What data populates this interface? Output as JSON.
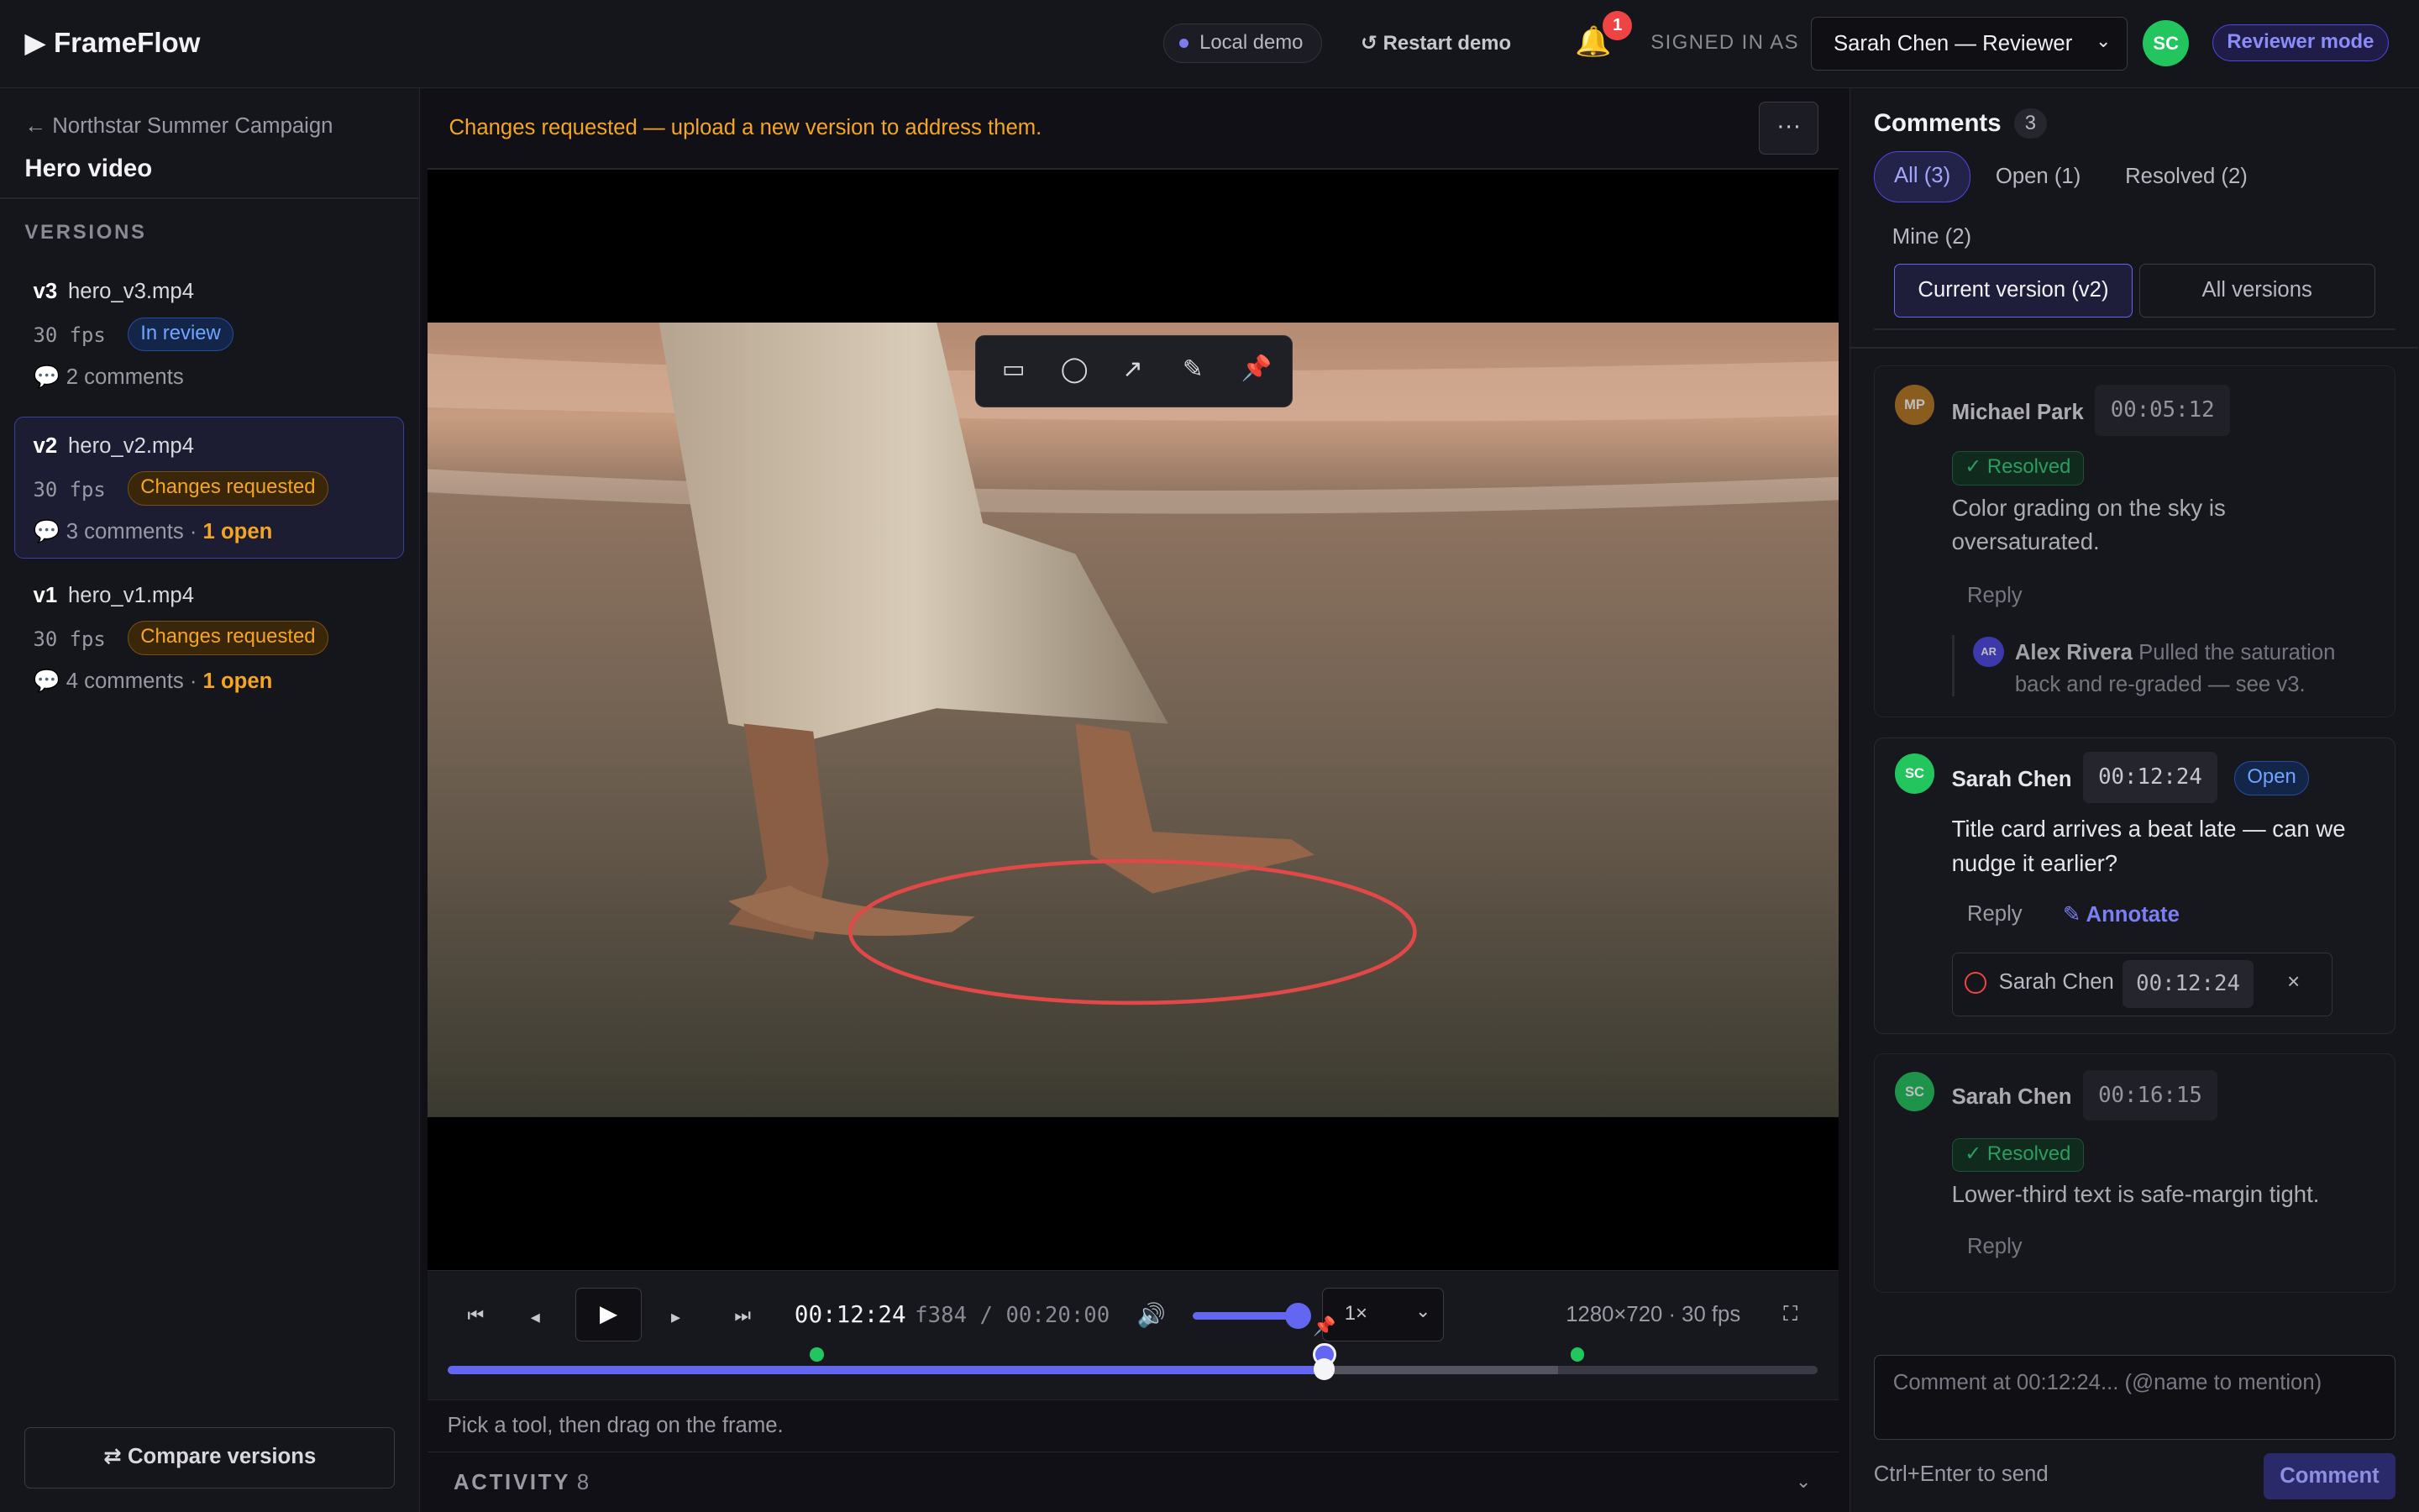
{
  "app": {
    "brand": "▶ FrameFlow"
  },
  "header": {
    "demo_label": "Local demo",
    "restart_label": "↺ Restart demo",
    "notification_count": "1",
    "signed_in_as": "SIGNED IN AS",
    "user_select_value": "Sarah Chen — Reviewer",
    "user_initials": "SC",
    "mode_badge": "Reviewer mode"
  },
  "sidebar": {
    "breadcrumb": "← Northstar Summer Campaign",
    "title": "Hero video",
    "versions_heading": "VERSIONS",
    "versions": [
      {
        "tag": "v3",
        "file": "hero_v3.mp4",
        "fps": "30 fps",
        "status": "In review",
        "comments": "2 comments",
        "open": ""
      },
      {
        "tag": "v2",
        "file": "hero_v2.mp4",
        "fps": "30 fps",
        "status": "Changes requested",
        "comments": "3 comments · ",
        "open": "1 open"
      },
      {
        "tag": "v1",
        "file": "hero_v1.mp4",
        "fps": "30 fps",
        "status": "Changes requested",
        "comments": "4 comments · ",
        "open": "1 open"
      }
    ],
    "compare_label": "⇄ Compare versions"
  },
  "main": {
    "status_message": "Changes requested — upload a new version to address them.",
    "more_label": "···",
    "annotation_tools": [
      "▭",
      "◯",
      "↗",
      "✎",
      "📌"
    ],
    "controls": {
      "timecode": "00:12:24",
      "frame_info": "f384 / 00:20:00",
      "speed": "1×",
      "resolution": "1280×720 · 30 fps",
      "volume": 0.85,
      "playhead_fraction": 0.64
    },
    "hint": "Pick a tool, then drag on the frame.",
    "activity_label": "ACTIVITY",
    "activity_count": "8"
  },
  "comments_panel": {
    "title": "Comments",
    "count": "3",
    "filters": [
      "All (3)",
      "Open (1)",
      "Resolved (2)",
      "Mine (2)"
    ],
    "scope": [
      "Current version (v2)",
      "All versions"
    ],
    "comments": [
      {
        "initials": "MP",
        "author": "Michael Park",
        "time": "00:05:12",
        "status": "✓ Resolved",
        "text": "Color grading on the sky is oversaturated.",
        "reply": "Reply",
        "thread_initials": "AR",
        "thread_author": "Alex Rivera",
        "thread_text": "Pulled the saturation back and re-graded — see v3."
      },
      {
        "initials": "SC",
        "author": "Sarah Chen",
        "time": "00:12:24",
        "status": "Open",
        "text": "Title card arrives a beat late — can we nudge it earlier?",
        "reply": "Reply",
        "annotate": "✎ Annotate",
        "ann_author": "Sarah Chen",
        "ann_time": "00:12:24"
      },
      {
        "initials": "SC",
        "author": "Sarah Chen",
        "time": "00:16:15",
        "status": "✓ Resolved",
        "text": "Lower-third text is safe-margin tight.",
        "reply": "Reply"
      }
    ],
    "compose_placeholder": "Comment at 00:12:24... (@name to mention)",
    "send_hint": "Ctrl+Enter to send",
    "comment_button": "Comment"
  }
}
